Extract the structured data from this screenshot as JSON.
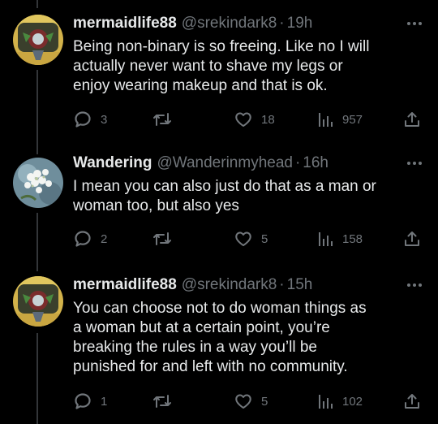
{
  "tweets": [
    {
      "name": "mermaidlife88",
      "handle": "@srekindark8",
      "separator": "·",
      "time": "19h",
      "lines": [
        "Being non-binary is so freeing. Like no I will",
        "actually never want to shave my legs or",
        "enjoy wearing makeup and that is ok."
      ],
      "replies": "3",
      "retweets": "",
      "likes": "18",
      "views": "957",
      "avatar_icon": "mermaid-avatar"
    },
    {
      "name": "Wandering",
      "handle": "@Wanderinmyhead",
      "separator": "·",
      "time": "16h",
      "lines": [
        "I mean you can also just do that as a man or",
        "woman too, but also yes"
      ],
      "replies": "2",
      "retweets": "",
      "likes": "5",
      "views": "158",
      "avatar_icon": "flowers-avatar"
    },
    {
      "name": "mermaidlife88",
      "handle": "@srekindark8",
      "separator": "·",
      "time": "15h",
      "lines": [
        "You can choose not to do woman things as",
        "a woman but at a certain point, you’re",
        "breaking the rules in a way you’ll be",
        "punished for and left with no community."
      ],
      "replies": "1",
      "retweets": "",
      "likes": "5",
      "views": "102",
      "avatar_icon": "mermaid-avatar"
    }
  ],
  "colors": {
    "background": "#000000",
    "text_primary": "#e7e9ea",
    "text_secondary": "#71767b",
    "thread_line": "#333639"
  }
}
